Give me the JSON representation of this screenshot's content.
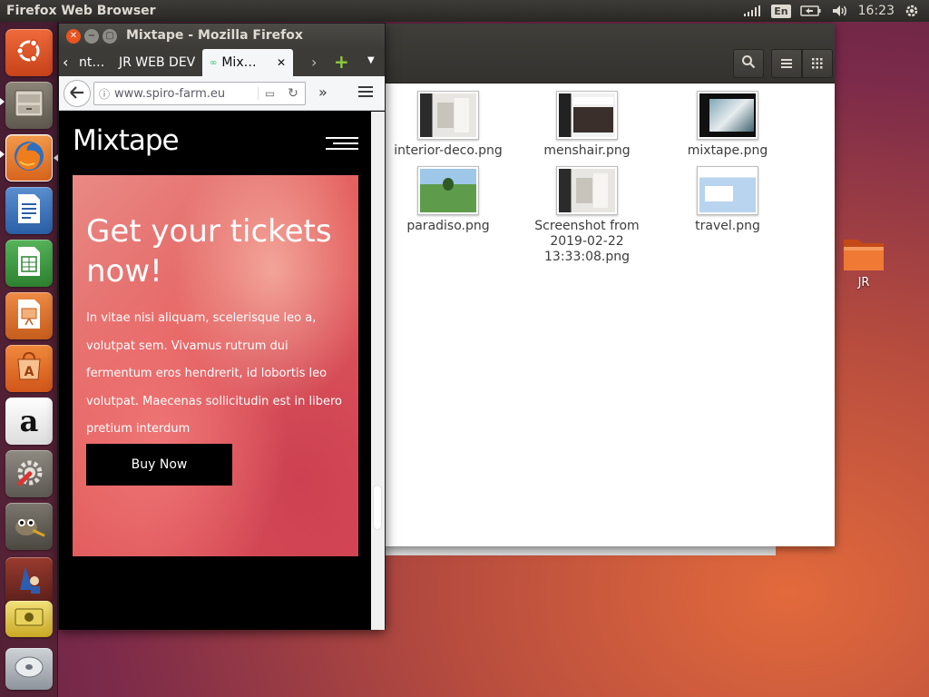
{
  "panel": {
    "app_title": "Firefox Web Browser",
    "keyboard_layout": "En",
    "clock": "16:23"
  },
  "launcher": {
    "items": [
      {
        "name": "Ubuntu Dash",
        "icon": "ubuntu-logo-icon"
      },
      {
        "name": "Files",
        "icon": "file-cabinet-icon"
      },
      {
        "name": "Firefox Web Browser",
        "icon": "firefox-icon"
      },
      {
        "name": "LibreOffice Writer",
        "icon": "writer-icon"
      },
      {
        "name": "LibreOffice Calc",
        "icon": "calc-icon"
      },
      {
        "name": "LibreOffice Impress",
        "icon": "impress-icon"
      },
      {
        "name": "Ubuntu Software",
        "icon": "software-center-icon"
      },
      {
        "name": "Amazon",
        "icon": "amazon-icon",
        "glyph": "a"
      },
      {
        "name": "System Settings",
        "icon": "settings-icon"
      },
      {
        "name": "GIMP",
        "icon": "gimp-icon"
      },
      {
        "name": "App",
        "icon": "wizard-icon"
      },
      {
        "name": "Disks",
        "icon": "disk-icon"
      },
      {
        "name": "DVD",
        "icon": "dvd-icon"
      }
    ]
  },
  "firefox": {
    "window_title": "Mixtape - Mozilla Firefox",
    "tabs": [
      {
        "label": "nt…"
      },
      {
        "label": "JR WEB DEV"
      },
      {
        "label": "Mix…"
      }
    ],
    "url": "www.spiro-farm.eu",
    "site": {
      "logo": "Mixtape",
      "hero_title": "Get your tickets now!",
      "hero_text": "In vitae nisi aliquam, scelerisque leo a, volutpat sem. Vivamus rutrum dui fermentum eros hendrerit, id lobortis leo volutpat. Maecenas sollicitudin est in libero pretium interdum",
      "cta": "Buy Now"
    }
  },
  "files": {
    "items": [
      {
        "name": "interior-deco.png",
        "theme": "interior"
      },
      {
        "name": "menshair.png",
        "theme": "menshair"
      },
      {
        "name": "mixtape.png",
        "theme": "mixtape"
      },
      {
        "name": "paradiso.png",
        "theme": "paradiso"
      },
      {
        "name": "Screenshot from 2019-02-22 13:33:08.png",
        "theme": "interior"
      },
      {
        "name": "travel.png",
        "theme": "travel"
      }
    ]
  },
  "desktop": {
    "folder_label": "JR"
  },
  "colors": {
    "ubuntu_orange": "#e95420",
    "panel_dark": "#3c3b37",
    "hero_coral": "#e4605f"
  }
}
